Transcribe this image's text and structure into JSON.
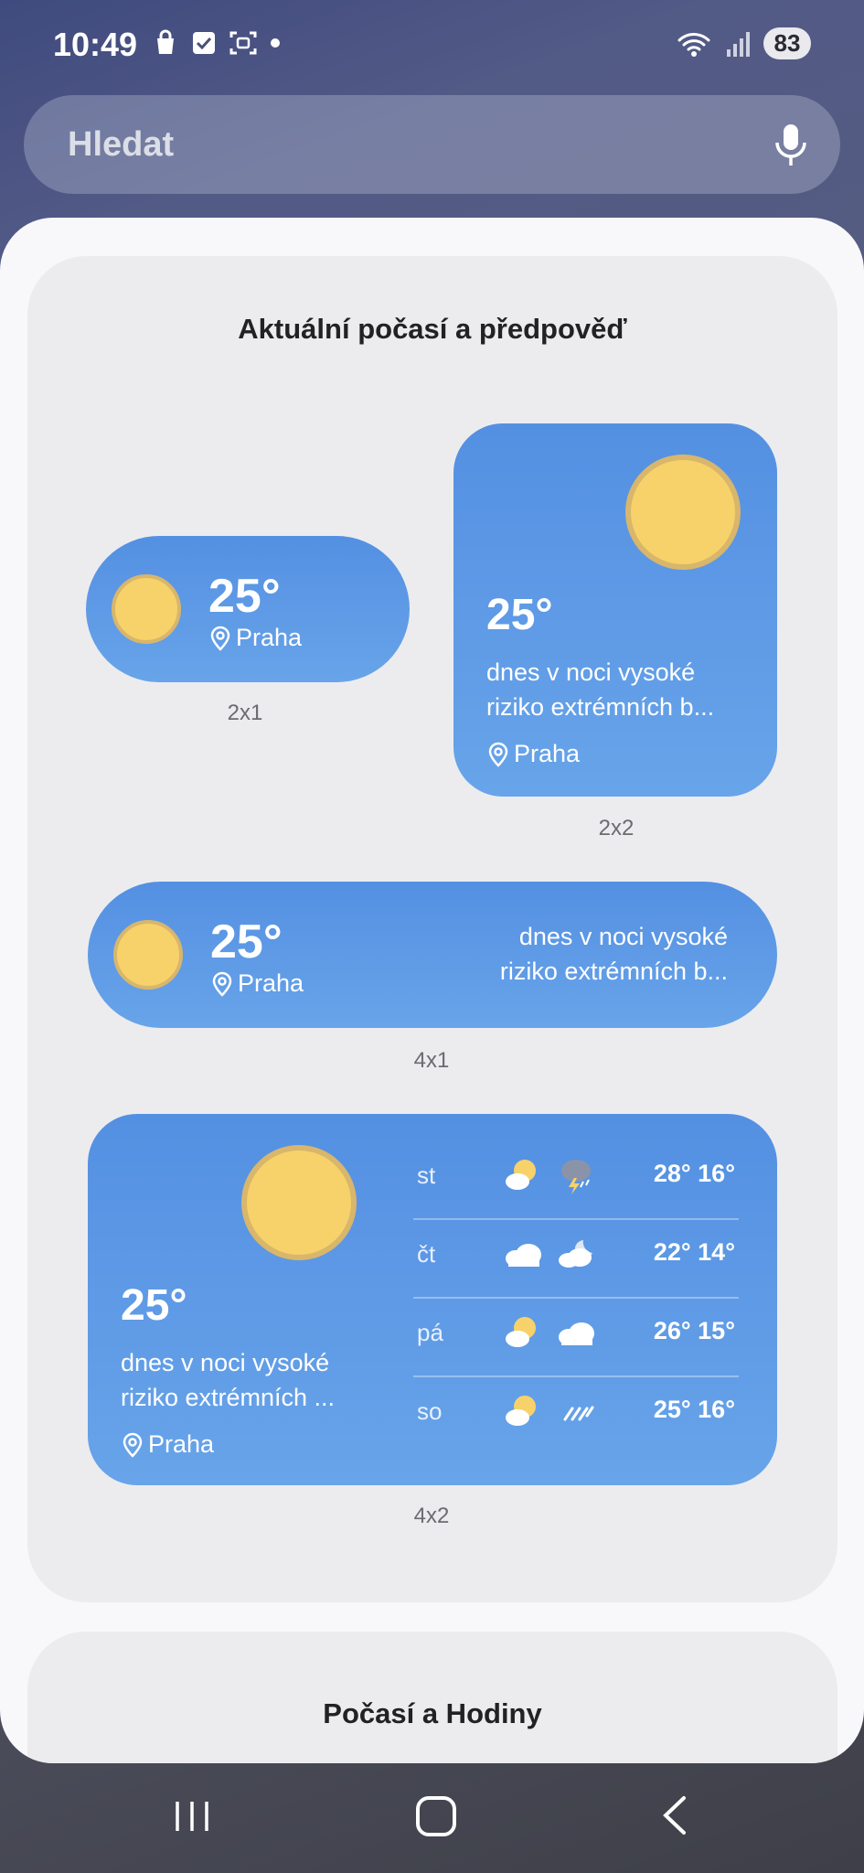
{
  "status": {
    "time": "10:49",
    "battery": "83",
    "icons": [
      "shopping-bag-icon",
      "checkbox-icon",
      "screenshot-icon",
      "dot-icon",
      "wifi-icon",
      "signal-icon"
    ]
  },
  "search": {
    "placeholder": "Hledat",
    "icon": "microphone-icon"
  },
  "section": {
    "title": "Aktuální počasí a předpověď",
    "widgets": {
      "w2x1": {
        "temp": "25°",
        "location": "Praha",
        "label": "2x1"
      },
      "w2x2": {
        "temp": "25°",
        "desc_line1": "dnes v noci vysoké",
        "desc_line2": "riziko extrémních b...",
        "location": "Praha",
        "label": "2x2"
      },
      "w4x1": {
        "temp": "25°",
        "location": "Praha",
        "desc_line1": "dnes v noci vysoké",
        "desc_line2": "riziko extrémních b...",
        "label": "4x1"
      },
      "w4x2": {
        "temp": "25°",
        "desc_line1": "dnes v noci vysoké",
        "desc_line2": "riziko extrémních ...",
        "location": "Praha",
        "label": "4x2",
        "forecast": [
          {
            "day": "st",
            "icons": [
              "partly-sunny-icon",
              "thunderstorm-icon"
            ],
            "temps": "28° 16°"
          },
          {
            "day": "čt",
            "icons": [
              "cloud-icon",
              "cloudy-night-icon"
            ],
            "temps": "22° 14°"
          },
          {
            "day": "pá",
            "icons": [
              "partly-sunny-icon",
              "cloud-icon"
            ],
            "temps": "26° 15°"
          },
          {
            "day": "so",
            "icons": [
              "partly-sunny-icon",
              "rain-icon"
            ],
            "temps": "25° 16°"
          }
        ]
      }
    }
  },
  "section2": {
    "title": "Počasí a Hodiny"
  },
  "colors": {
    "widget_top": "#5490e2",
    "widget_bottom": "#68a4e9",
    "sun": "#f7d26a",
    "card": "#ececef"
  }
}
